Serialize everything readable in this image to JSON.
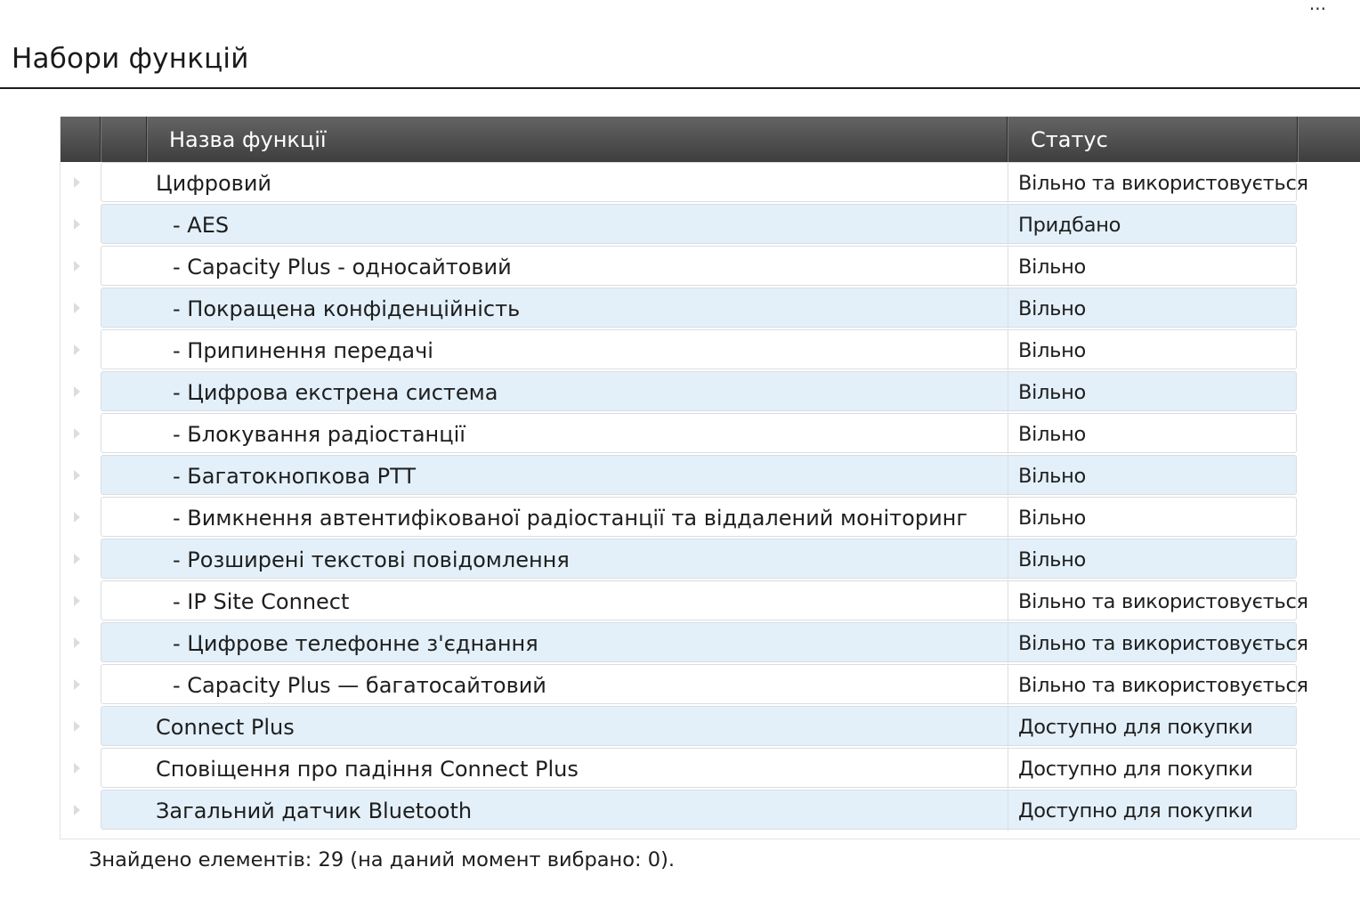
{
  "page": {
    "title": "Набори функцій",
    "corner_mark": "..."
  },
  "table": {
    "columns": [
      {
        "label": ""
      },
      {
        "label": "Назва функції"
      },
      {
        "label": "Статус"
      }
    ],
    "rows": [
      {
        "name": "Цифровий",
        "status": "Вільно та використовується",
        "level": 0
      },
      {
        "name": "- AES",
        "status": "Придбано",
        "level": 1
      },
      {
        "name": "- Capacity Plus - односайтовий",
        "status": "Вільно",
        "level": 1
      },
      {
        "name": "- Покращена конфіденційність",
        "status": "Вільно",
        "level": 1
      },
      {
        "name": "- Припинення передачі",
        "status": "Вільно",
        "level": 1
      },
      {
        "name": "- Цифрова екстрена система",
        "status": "Вільно",
        "level": 1
      },
      {
        "name": "- Блокування радіостанції",
        "status": "Вільно",
        "level": 1
      },
      {
        "name": "- Багатокнопкова PTT",
        "status": "Вільно",
        "level": 1
      },
      {
        "name": "- Вимкнення автентифікованої радіостанції та віддалений моніторинг",
        "status": "Вільно",
        "level": 1
      },
      {
        "name": "- Розширені текстові повідомлення",
        "status": "Вільно",
        "level": 1
      },
      {
        "name": "- IP Site Connect",
        "status": "Вільно та використовується",
        "level": 1
      },
      {
        "name": "- Цифрове телефонне з'єднання",
        "status": "Вільно та використовується",
        "level": 1
      },
      {
        "name": "- Capacity Plus — багатосайтовий",
        "status": "Вільно та використовується",
        "level": 1
      },
      {
        "name": "Connect Plus",
        "status": "Доступно для покупки",
        "level": 0
      },
      {
        "name": "Сповіщення про падіння Connect Plus",
        "status": "Доступно для покупки",
        "level": 0
      },
      {
        "name": "Загальний датчик Bluetooth",
        "status": "Доступно для покупки",
        "level": 0
      }
    ]
  },
  "footer": {
    "summary": "Знайдено елементів: 29 (на даний момент вибрано: 0)."
  }
}
